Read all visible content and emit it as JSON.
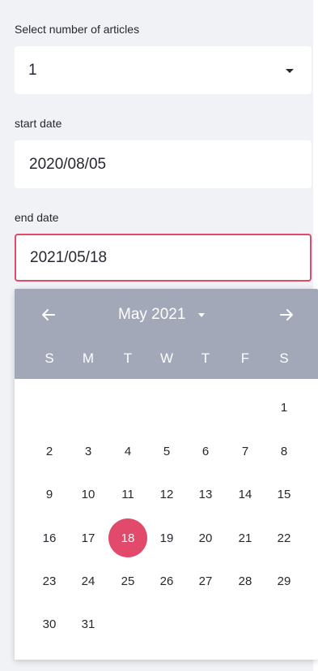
{
  "articles": {
    "label": "Select number of articles",
    "value": "1"
  },
  "start_date": {
    "label": "start date",
    "value": "2020/08/05"
  },
  "end_date": {
    "label": "end date",
    "value": "2021/05/18"
  },
  "calendar": {
    "month_label": "May 2021",
    "prev_icon": "arrow-left-icon",
    "next_icon": "arrow-right-icon",
    "weekdays": [
      "S",
      "M",
      "T",
      "W",
      "T",
      "F",
      "S"
    ],
    "days": [
      "1",
      "2",
      "3",
      "4",
      "5",
      "6",
      "7",
      "8",
      "9",
      "10",
      "11",
      "12",
      "13",
      "14",
      "15",
      "16",
      "17",
      "18",
      "19",
      "20",
      "21",
      "22",
      "23",
      "24",
      "25",
      "26",
      "27",
      "28",
      "29",
      "30",
      "31"
    ],
    "selected_day": "18",
    "accent_color": "#e14a6b",
    "header_color": "#a3a8b8"
  }
}
